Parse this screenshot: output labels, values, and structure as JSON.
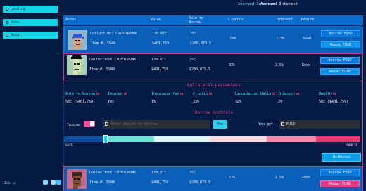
{
  "sidebar": {
    "items": [
      {
        "label": "Lending",
        "icon": "lock-icon"
      },
      {
        "label": "Dock",
        "icon": "dock-icon"
      },
      {
        "label": "About",
        "icon": "info-icon"
      }
    ],
    "join_label": "Join us"
  },
  "topbar": {
    "link1": "Accrued Interest",
    "link2": "Accrued Interest"
  },
  "table": {
    "headers": [
      "Asset",
      "Value",
      "Able to Borrow",
      "C-ratio",
      "Interest",
      "Health"
    ],
    "rows": [
      {
        "collection": "Collection: CRYPTOPUNK",
        "item": "Item #: 5940",
        "value_eth": "139.97Ξ",
        "value_usd": "$401,759",
        "able_eth": "25Ξ",
        "able_usd": "$200,879.5",
        "c_ratio": "33%",
        "interest": "2.5%",
        "health": "Good",
        "borrow": "Borrow FUSD",
        "repay": "Repay FUSD"
      },
      {
        "collection": "Collection: CRYPTOPUNK",
        "item": "Item #: 5940",
        "value_eth": "139.97Ξ",
        "value_usd": "$401,759",
        "able_eth": "25Ξ",
        "able_usd": "$200,879.5",
        "c_ratio": "33%",
        "interest": "2.5%",
        "health": "Good",
        "borrow": "Borrow FUSD",
        "repay": "Repay FUSD"
      },
      {
        "collection": "Collection: CRYPTOPUNK",
        "item": "Item #: 5940",
        "value_eth": "139.97Ξ",
        "value_usd": "$401,759",
        "able_eth": "25Ξ",
        "able_usd": "$200,879.5",
        "c_ratio": "33%",
        "interest": "2.5%",
        "health": "Good",
        "borrow": "Borrow FUSD",
        "repay": "Repay FUSD"
      }
    ]
  },
  "collateral": {
    "title": "Collateral parameters",
    "params": [
      {
        "label": "Able to Borrow",
        "value": "50Ξ ($401,759)"
      },
      {
        "label": "Insured",
        "value": "Yes"
      },
      {
        "label": "Insurance fee",
        "value": "1%"
      },
      {
        "label": "C-ratio",
        "value": "33%"
      },
      {
        "label": "Liquidation Ratio",
        "value": "32%"
      },
      {
        "label": "Interest",
        "value": "2%"
      },
      {
        "label": "Health",
        "value": "50Ξ ($401,759)"
      }
    ]
  },
  "borrow": {
    "title": "Borrow Controls",
    "insure_label": "Insure",
    "insure_on": true,
    "amount_placeholder": "Enter Amount to Borrow",
    "max_label": "Max",
    "you_get_label": "You get",
    "you_get_value": "FUSD",
    "safe_label": "SAFE",
    "punk_label": "PUNK'D",
    "slider_fraction": 0.14,
    "withdraw_label": "Withdraw"
  },
  "colors": {
    "accent": "#13d3e6",
    "pink": "#f2468a",
    "header_blue": "#0a6bcc"
  }
}
